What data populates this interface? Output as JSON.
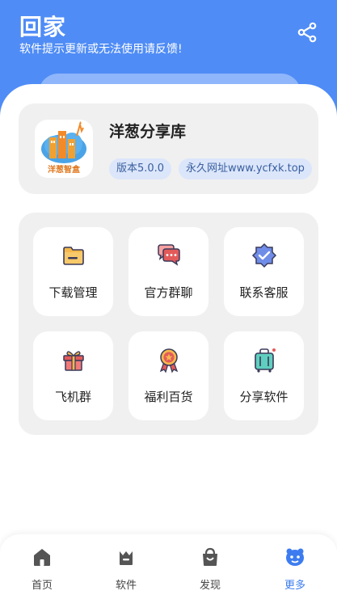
{
  "header": {
    "title": "回家",
    "subtitle": "软件提示更新或无法使用请反馈!",
    "share_icon": "share-icon"
  },
  "app_info": {
    "name": "洋葱分享库",
    "version": "版本5.0.0",
    "permanent_url": "永久网址www.ycfxk.top",
    "logo_text": "洋葱智盒"
  },
  "menu": [
    {
      "label": "下载管理",
      "icon": "folder-icon"
    },
    {
      "label": "官方群聊",
      "icon": "chat-icon"
    },
    {
      "label": "联系客服",
      "icon": "verified-badge-icon"
    },
    {
      "label": "飞机群",
      "icon": "gift-icon"
    },
    {
      "label": "福利百货",
      "icon": "medal-icon"
    },
    {
      "label": "分享软件",
      "icon": "luggage-icon"
    }
  ],
  "bottom_nav": [
    {
      "label": "首页",
      "icon": "home-icon"
    },
    {
      "label": "软件",
      "icon": "software-icon"
    },
    {
      "label": "发现",
      "icon": "discover-bag-icon"
    },
    {
      "label": "更多",
      "icon": "more-mascot-icon",
      "active": true
    }
  ],
  "colors": {
    "primary": "#4f8cf6",
    "active_nav": "#3d7cf0",
    "card_bg": "#f0f0f0",
    "tag_bg": "#dbe6fb"
  }
}
